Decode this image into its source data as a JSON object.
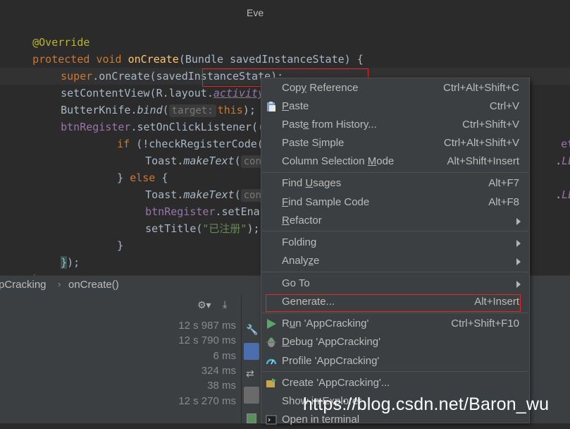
{
  "code": {
    "l1_annotation": "@Override",
    "l2_kw1": "protected",
    "l2_kw2": "void",
    "l2_method": "onCreate",
    "l2_rest": "(Bundle savedInstanceState) {",
    "l3_super": "super",
    "l3_rest": ".onCreate(savedInstanceState);",
    "l4_a": "setContentView(R.layout.",
    "l4_res": "activity_app_cracking",
    "l4_end": ");",
    "l5_a": "ButterKnife.",
    "l5_bind": "bind",
    "l5_paren": "(",
    "l5_hint": "target:",
    "l5_this": "this",
    "l5_end": ");",
    "l6_field": "btnRegister",
    "l6_a": ".setOnClickListener((",
    "l7_if": "if",
    "l7_a": " (!checkRegisterCode(e",
    "l7_right": "etReg",
    "l8_a": "Toast.",
    "l8_make": "makeText",
    "l8_b": "(",
    "l8_hint": "conte",
    "l8_right_dot": ".",
    "l8_right": "LENGT",
    "l9_a": "} ",
    "l9_else": "else",
    "l9_b": " {",
    "l10_a": "Toast.",
    "l10_make": "makeText",
    "l10_b": "(",
    "l10_hint": "conte",
    "l10_right_dot": ".",
    "l10_right": "LENGT",
    "l11_field": "btnRegister",
    "l11_a": ".setEnabl",
    "l12_a": "setTitle(",
    "l12_str": "\"已注册\"",
    "l12_end": ");",
    "l13": "}",
    "l14_a": "}",
    "l14_b": ");",
    "l15": "}"
  },
  "breadcrumb": {
    "class_name": "pCracking",
    "method_name": "onCreate()"
  },
  "bottom_panel": {
    "right_tab_label": "Eve",
    "timings": [
      "12 s 987 ms",
      "12 s 790 ms",
      "6 ms",
      "324 ms",
      "38 ms",
      "12 s 270 ms"
    ]
  },
  "context_menu": {
    "items": [
      {
        "label_pre": "Cop",
        "label_u": "y",
        "label_post": " Reference",
        "shortcut": "Ctrl+Alt+Shift+C"
      },
      {
        "label_pre": "",
        "label_u": "P",
        "label_post": "aste",
        "shortcut": "Ctrl+V",
        "icon": "clipboard-icon"
      },
      {
        "label_pre": "Past",
        "label_u": "e",
        "label_post": " from History...",
        "shortcut": "Ctrl+Shift+V"
      },
      {
        "label_pre": "Paste S",
        "label_u": "i",
        "label_post": "mple",
        "shortcut": "Ctrl+Alt+Shift+V"
      },
      {
        "label_pre": "Column Selection ",
        "label_u": "M",
        "label_post": "ode",
        "shortcut": "Alt+Shift+Insert"
      },
      {
        "label_pre": "Find ",
        "label_u": "U",
        "label_post": "sages",
        "shortcut": "Alt+F7"
      },
      {
        "label_pre": "",
        "label_u": "F",
        "label_post": "ind Sample Code",
        "shortcut": "Alt+F8"
      },
      {
        "label_pre": "",
        "label_u": "R",
        "label_post": "efactor",
        "submenu": true
      },
      {
        "label_pre": "Folding",
        "label_u": "",
        "label_post": "",
        "submenu": true
      },
      {
        "label_pre": "Analy",
        "label_u": "z",
        "label_post": "e",
        "submenu": true
      },
      {
        "label_pre": "Go To",
        "label_u": "",
        "label_post": "",
        "submenu": true
      },
      {
        "label_pre": "Generate...",
        "label_u": "",
        "label_post": "",
        "shortcut": "Alt+Insert"
      },
      {
        "label_pre": "R",
        "label_u": "u",
        "label_post": "n 'AppCracking'",
        "shortcut": "Ctrl+Shift+F10",
        "icon": "run-icon"
      },
      {
        "label_pre": "",
        "label_u": "D",
        "label_post": "ebug 'AppCracking'",
        "icon": "debug-icon"
      },
      {
        "label_pre": "Profile 'AppCracking'",
        "label_u": "",
        "label_post": "",
        "icon": "profile-icon"
      },
      {
        "label_pre": "Create 'AppCracking'...",
        "label_u": "",
        "label_post": "",
        "icon": "create-config-icon"
      },
      {
        "label_pre": "Show in Explorer",
        "label_u": "",
        "label_post": ""
      },
      {
        "label_pre": "Open in terminal",
        "label_u": "",
        "label_post": "",
        "icon": "terminal-icon"
      }
    ]
  },
  "colors": {
    "highlight_box": "#e0292a",
    "run_icon": "#59a869",
    "profile_icon": "#40b6e0"
  },
  "watermark": "https://blog.csdn.net/Baron_wu"
}
